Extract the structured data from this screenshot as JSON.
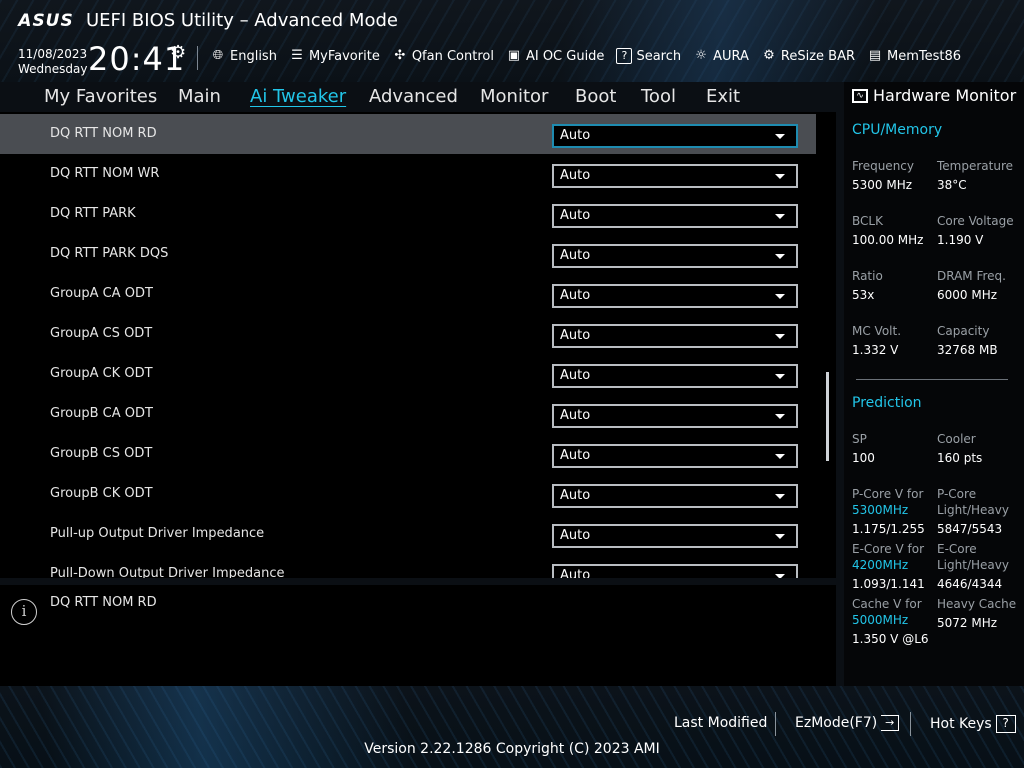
{
  "header": {
    "brand": "ASUS",
    "title": "UEFI BIOS Utility – Advanced Mode",
    "date": "11/08/2023",
    "weekday": "Wednesday",
    "time": "20:41"
  },
  "toolbar": [
    {
      "label": "English",
      "icon": "globe-icon"
    },
    {
      "label": "MyFavorite",
      "icon": "favorite-list-icon"
    },
    {
      "label": "Qfan Control",
      "icon": "fan-icon"
    },
    {
      "label": "AI OC Guide",
      "icon": "chip-icon"
    },
    {
      "label": "Search",
      "icon": "question-box-icon"
    },
    {
      "label": "AURA",
      "icon": "aura-light-icon"
    },
    {
      "label": "ReSize BAR",
      "icon": "resize-bar-icon"
    },
    {
      "label": "MemTest86",
      "icon": "memory-icon"
    }
  ],
  "nav": {
    "tabs": [
      "My Favorites",
      "Main",
      "Ai Tweaker",
      "Advanced",
      "Monitor",
      "Boot",
      "Tool",
      "Exit"
    ],
    "active": "Ai Tweaker"
  },
  "settings": [
    {
      "label": "DQ RTT NOM RD",
      "value": "Auto"
    },
    {
      "label": "DQ RTT NOM WR",
      "value": "Auto"
    },
    {
      "label": "DQ RTT PARK",
      "value": "Auto"
    },
    {
      "label": "DQ RTT PARK DQS",
      "value": "Auto"
    },
    {
      "label": "GroupA CA ODT",
      "value": "Auto"
    },
    {
      "label": "GroupA CS ODT",
      "value": "Auto"
    },
    {
      "label": "GroupA CK ODT",
      "value": "Auto"
    },
    {
      "label": "GroupB CA ODT",
      "value": "Auto"
    },
    {
      "label": "GroupB CS ODT",
      "value": "Auto"
    },
    {
      "label": "GroupB CK ODT",
      "value": "Auto"
    },
    {
      "label": "Pull-up Output Driver Impedance",
      "value": "Auto"
    },
    {
      "label": "Pull-Down Output Driver Impedance",
      "value": "Auto"
    }
  ],
  "help": {
    "text": "DQ RTT NOM RD"
  },
  "hardware_monitor": {
    "title": "Hardware Monitor",
    "cpu_memory": {
      "title": "CPU/Memory",
      "frequency_label": "Frequency",
      "frequency": "5300 MHz",
      "temperature_label": "Temperature",
      "temperature": "38°C",
      "bclk_label": "BCLK",
      "bclk": "100.00 MHz",
      "core_voltage_label": "Core Voltage",
      "core_voltage": "1.190 V",
      "ratio_label": "Ratio",
      "ratio": "53x",
      "dram_freq_label": "DRAM Freq.",
      "dram_freq": "6000 MHz",
      "mc_volt_label": "MC Volt.",
      "mc_volt": "1.332 V",
      "capacity_label": "Capacity",
      "capacity": "32768 MB"
    },
    "prediction": {
      "title": "Prediction",
      "sp_label": "SP",
      "sp": "100",
      "cooler_label": "Cooler",
      "cooler": "160 pts",
      "pcore_v_label": "P-Core V for",
      "pcore_v_freq": "5300MHz",
      "pcore_v": "1.175/1.255",
      "pcore_lh_label": "P-Core Light/Heavy",
      "pcore_lh": "5847/5543",
      "ecore_v_label": "E-Core V for",
      "ecore_v_freq": "4200MHz",
      "ecore_v": "1.093/1.141",
      "ecore_lh_label": "E-Core Light/Heavy",
      "ecore_lh": "4646/4344",
      "cache_v_label": "Cache V for",
      "cache_v_freq": "5000MHz",
      "cache_v": "1.350 V @L6",
      "heavy_cache_label": "Heavy Cache",
      "heavy_cache": "5072 MHz"
    }
  },
  "footer": {
    "last_modified": "Last Modified",
    "ezmode": "EzMode(F7)",
    "hotkeys": "Hot Keys",
    "hotkeys_glyph": "?",
    "version": "Version 2.22.1286 Copyright (C) 2023 AMI"
  },
  "colors": {
    "accent": "#22c5e8",
    "selected_row": "#4a4d52",
    "select_border_focus": "#1e8bb0"
  }
}
